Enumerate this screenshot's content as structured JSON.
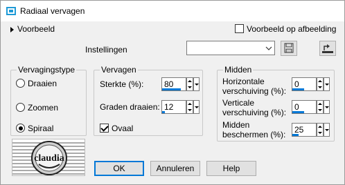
{
  "window": {
    "title": "Radiaal vervagen"
  },
  "preview": {
    "label": "Voorbeeld",
    "on_image_label": "Voorbeeld op afbeelding",
    "on_image_checked": false
  },
  "settings": {
    "label": "Instellingen",
    "value": ""
  },
  "type_group": {
    "title": "Vervagingstype",
    "options": [
      {
        "label": "Draaien",
        "selected": false
      },
      {
        "label": "Zoomen",
        "selected": false
      },
      {
        "label": "Spiraal",
        "selected": true
      }
    ]
  },
  "blur_group": {
    "title": "Vervagen",
    "strength": {
      "label": "Sterkte (%):",
      "value": "80",
      "level": 0.8
    },
    "twist": {
      "label": "Graden draaien:",
      "value": "12",
      "level": 0.12
    },
    "oval": {
      "label": "Ovaal",
      "checked": true
    }
  },
  "center_group": {
    "title": "Midden",
    "horizontal": {
      "label_line1": "Horizontale",
      "label_line2": "verschuiving (%):",
      "value": "0",
      "level": 0.5
    },
    "vertical": {
      "label_line1": "Verticale",
      "label_line2": "verschuiving (%):",
      "value": "0",
      "level": 0.5
    },
    "protect": {
      "label_line1": "Midden",
      "label_line2": "beschermen (%):",
      "value": "25",
      "level": 0.25
    }
  },
  "buttons": {
    "ok": "OK",
    "cancel": "Annuleren",
    "help": "Help"
  },
  "logo": {
    "text": "claudia"
  },
  "colors": {
    "accent": "#0078d7",
    "dialog_bg": "#f0f0f0"
  }
}
